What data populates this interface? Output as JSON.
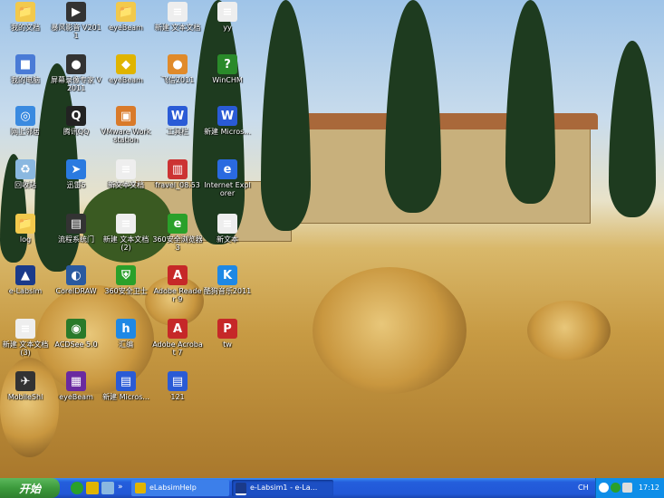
{
  "desktop": {
    "icons": [
      {
        "label": "我的文档",
        "glyph": "📁",
        "color": "#f2c94c"
      },
      {
        "label": "暴风影音 V2011",
        "glyph": "▶",
        "color": "#333"
      },
      {
        "label": "eyeBeam",
        "glyph": "📁",
        "color": "#f2c94c"
      },
      {
        "label": "新建 文本文档",
        "glyph": "≡",
        "color": "#eee"
      },
      {
        "label": "yy",
        "glyph": "≡",
        "color": "#eee"
      },
      {
        "label": "我的电脑",
        "glyph": "■",
        "color": "#4a7bd6"
      },
      {
        "label": "屏幕录像专家 V2011",
        "glyph": "●",
        "color": "#333"
      },
      {
        "label": "eyeBeam",
        "glyph": "◆",
        "color": "#e0b400"
      },
      {
        "label": "飞信2011",
        "glyph": "●",
        "color": "#e08a2a"
      },
      {
        "label": "WinCHM",
        "glyph": "?",
        "color": "#2a8a2a"
      },
      {
        "label": "网上邻居",
        "glyph": "◎",
        "color": "#3a8ae0"
      },
      {
        "label": "腾讯QQ",
        "glyph": "Q",
        "color": "#222"
      },
      {
        "label": "VMware Workstation",
        "glyph": "▣",
        "color": "#d97a2a"
      },
      {
        "label": "工具栏",
        "glyph": "W",
        "color": "#2a5bd6"
      },
      {
        "label": "新建 Micros...",
        "glyph": "W",
        "color": "#2a5bd6"
      },
      {
        "label": "回收站",
        "glyph": "♻",
        "color": "#8ab8e0"
      },
      {
        "label": "迅雷5",
        "glyph": "➤",
        "color": "#2a7ae0"
      },
      {
        "label": "新文本文档",
        "glyph": "≡",
        "color": "#eee"
      },
      {
        "label": "fravel_08.53",
        "glyph": "▥",
        "color": "#c33"
      },
      {
        "label": "Internet Explorer",
        "glyph": "e",
        "color": "#2a6ae0"
      },
      {
        "label": "log",
        "glyph": "📁",
        "color": "#f2c94c"
      },
      {
        "label": "流程系统门",
        "glyph": "▤",
        "color": "#333"
      },
      {
        "label": "新建 文本文档 (2)",
        "glyph": "≡",
        "color": "#eee"
      },
      {
        "label": "360安全浏览器 3",
        "glyph": "e",
        "color": "#2aa02a"
      },
      {
        "label": "新文本",
        "glyph": "≡",
        "color": "#eee"
      },
      {
        "label": "e-Labsim",
        "glyph": "▲",
        "color": "#1a3a8a"
      },
      {
        "label": "CorelDRAW",
        "glyph": "◐",
        "color": "#2a5aa0"
      },
      {
        "label": "360安全卫士",
        "glyph": "⛨",
        "color": "#2aa02a"
      },
      {
        "label": "Adobe Reader 9",
        "glyph": "A",
        "color": "#c62828"
      },
      {
        "label": "酷狗音乐2011",
        "glyph": "K",
        "color": "#1e88e5"
      },
      {
        "label": "新建 文本文档 (3)",
        "glyph": "≡",
        "color": "#eee"
      },
      {
        "label": "ACDSee 5.0",
        "glyph": "◉",
        "color": "#2a7a2a"
      },
      {
        "label": "汇编",
        "glyph": "h",
        "color": "#1e88e5"
      },
      {
        "label": "Adobe Acrobat 7",
        "glyph": "A",
        "color": "#c62828"
      },
      {
        "label": "tw",
        "glyph": "P",
        "color": "#c62828"
      },
      {
        "label": "MobileShl",
        "glyph": "✈",
        "color": "#333"
      },
      {
        "label": "eyeBeam",
        "glyph": "▦",
        "color": "#6a2aa0"
      },
      {
        "label": "新建 Micros...",
        "glyph": "▤",
        "color": "#2a5bd6"
      },
      {
        "label": "121",
        "glyph": "▤",
        "color": "#2a5bd6"
      }
    ]
  },
  "taskbar": {
    "start_label": "开始",
    "tasks": [
      {
        "label": "eLabsimHelp"
      },
      {
        "label": "e-Labsim1 - e-La..."
      }
    ],
    "ime": "CH",
    "clock": "17:12"
  }
}
